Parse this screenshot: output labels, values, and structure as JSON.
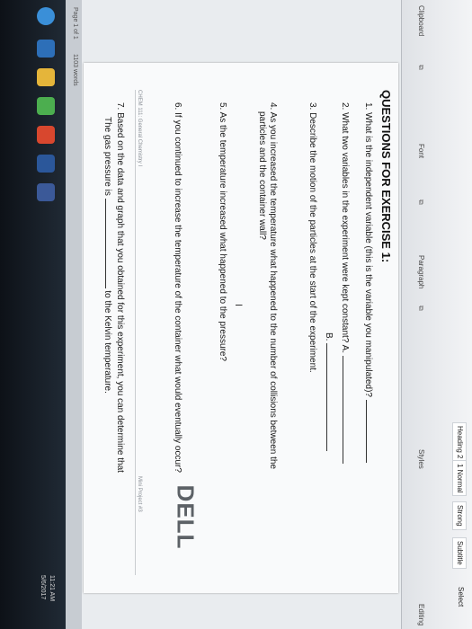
{
  "ribbon": {
    "clipboard": "Clipboard",
    "font": "Font",
    "paragraph": "Paragraph",
    "styles": "Styles",
    "editing": "Editing",
    "style_items": [
      "Heading 2",
      "1 Normal",
      "Strong",
      "Subtitle"
    ],
    "select": "Select"
  },
  "status": {
    "page": "Page 1 of 1",
    "words": "1103 words"
  },
  "document": {
    "heading": "QUESTIONS FOR EXERCISE 1:",
    "q1": "1. What is the independent variable (this is the variable you manipulated)?",
    "q2": "2. What two variables in the experiment were kept constant? A.",
    "q2b": "B.",
    "q3": "3. Describe the motion of the particles at the start of the experiment.",
    "q4a": "4. As you increased the temperature what happened to the number of collisions between the",
    "q4b": "particles and the container wall?",
    "q5": "5. As the temperature increased what happened to the pressure?",
    "q6": "6. If you continued to increase the temperature of the container what would eventually occur?",
    "footer_left": "CHEM 111: General Chemistry I",
    "footer_right": "Mini Project #3",
    "q7a": "7. Based on the data and graph that you obtained for this experiment, you can determine that",
    "q7b": "The gas pressure is",
    "q7c": "to the Kelvin temperature."
  },
  "clock": {
    "time": "11:21 AM",
    "date": "5/6/2017"
  },
  "brand": "DELL"
}
